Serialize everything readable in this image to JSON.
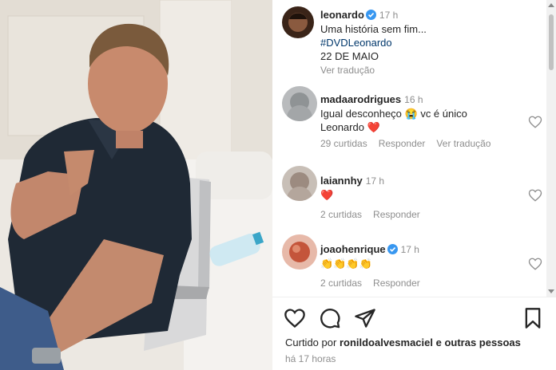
{
  "post": {
    "username": "leonardo",
    "time": "17 h",
    "caption_line1": "Uma história sem fim...",
    "caption_hashtag": "#DVDLeonardo",
    "caption_date": "22 DE MAIO",
    "translate": "Ver tradução"
  },
  "comments": [
    {
      "username": "madaarodrigues",
      "time": "16 h",
      "text_line1": "Igual desconheço 😭 vc é único",
      "text_line2": "Leonardo ❤️",
      "likes": "29 curtidas",
      "reply": "Responder",
      "translate": "Ver tradução"
    },
    {
      "username": "laiannhy",
      "time": "17 h",
      "text": "❤️",
      "likes": "2 curtidas",
      "reply": "Responder"
    },
    {
      "username": "joaohenrique",
      "time": "17 h",
      "text": "👏👏👏👏",
      "likes": "2 curtidas",
      "reply": "Responder"
    }
  ],
  "footer": {
    "liked_prefix": "Curtido por",
    "liked_user": "ronildoalvesmaciel",
    "liked_suffix": "e outras pessoas",
    "ago": "há 17 horas"
  },
  "icons": {
    "like": "heart-outline-icon",
    "comment": "speech-bubble-icon",
    "share": "paper-plane-icon",
    "save": "bookmark-icon",
    "verified": "verified-badge-icon"
  },
  "colors": {
    "verified": "#3897f0",
    "link": "#00376b",
    "muted": "#8e8e8e",
    "red_heart": "#e0201f"
  }
}
